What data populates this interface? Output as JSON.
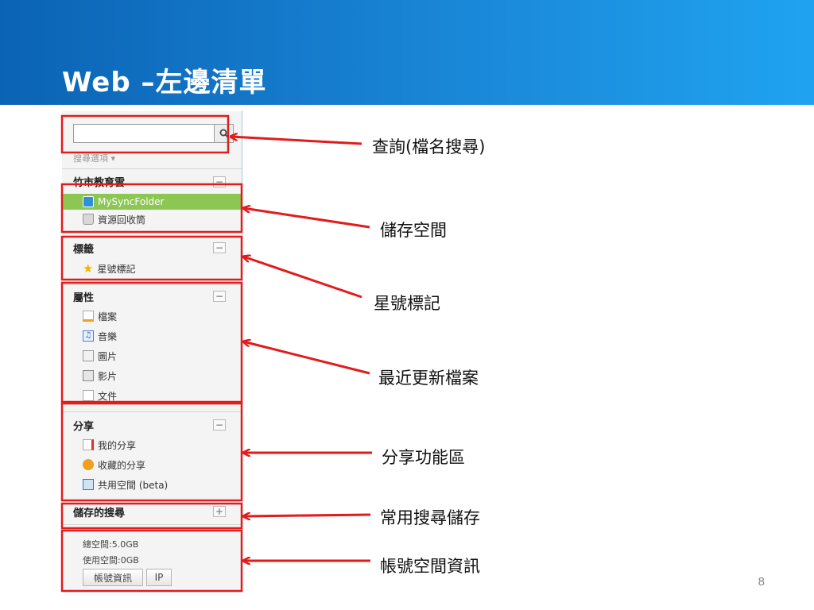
{
  "slide": {
    "title": "Web –左邊清單",
    "page_number": "8"
  },
  "colors": {
    "header_gradient": [
      "#0b63b5",
      "#1fa3f0"
    ],
    "annotation_red": "#e01c1c",
    "selected_green": "#8cc653"
  },
  "sidebar": {
    "search_value": "",
    "search_options_label": "搜尋選項 ▾",
    "org_group": {
      "title": "竹市教育雲",
      "toggle": "−",
      "items": [
        {
          "label": "MySyncFolder",
          "icon": "cloud-folder-icon",
          "selected": true
        },
        {
          "label": "資源回收筒",
          "icon": "trash-icon",
          "selected": false
        }
      ]
    },
    "tags_group": {
      "title": "標籤",
      "toggle": "−",
      "items": [
        {
          "label": "星號標記",
          "icon": "star-icon"
        }
      ]
    },
    "properties_group": {
      "title": "屬性",
      "toggle": "−",
      "items": [
        {
          "label": "檔案",
          "icon": "pencil-file-icon"
        },
        {
          "label": "音樂",
          "icon": "music-file-icon"
        },
        {
          "label": "圖片",
          "icon": "image-file-icon"
        },
        {
          "label": "影片",
          "icon": "video-file-icon"
        },
        {
          "label": "文件",
          "icon": "document-file-icon"
        }
      ]
    },
    "share_group": {
      "title": "分享",
      "toggle": "−",
      "items": [
        {
          "label": "我的分享",
          "icon": "share-file-icon"
        },
        {
          "label": "收藏的分享",
          "icon": "favorite-share-icon"
        },
        {
          "label": "共用空間 (beta)",
          "icon": "shared-space-icon"
        }
      ]
    },
    "saved_search_group": {
      "title": "儲存的搜尋",
      "toggle": "+"
    },
    "quota": {
      "total": "總空間:5.0GB",
      "used": "使用空間:0GB",
      "account_button": "帳號資訊",
      "ip_button": "IP"
    }
  },
  "annotations": [
    {
      "label": "查詢(檔名搜尋)"
    },
    {
      "label": "儲存空間"
    },
    {
      "label": "星號標記"
    },
    {
      "label": "最近更新檔案"
    },
    {
      "label": "分享功能區"
    },
    {
      "label": "常用搜尋儲存"
    },
    {
      "label": "帳號空間資訊"
    }
  ]
}
